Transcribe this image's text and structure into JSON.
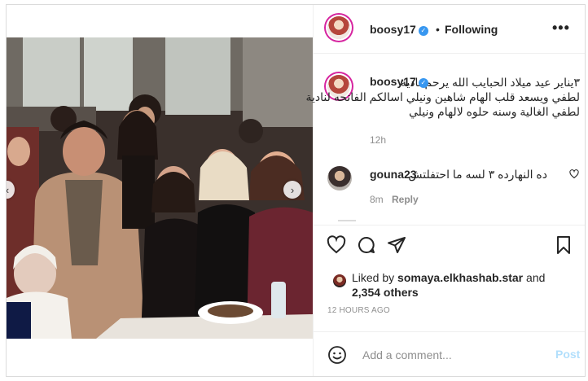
{
  "post": {
    "username": "boosy17",
    "header_separator": "•",
    "follow_status": "Following",
    "more_label": "•••",
    "caption_lines": [
      "٣يناير عيد ميلاد الحبايب الله يرحم نادية",
      "لطفي ويسعد قلب الهام شاهين ونيلي اسالكم الفاتحه لنادية",
      "لطفي الغالية وسنه حلوه لالهام ونيلي"
    ],
    "caption_time": "12h"
  },
  "comments": [
    {
      "username": "gouna23",
      "text": "ده النهارده ٣ لسه ما احتفلتش",
      "time": "8m",
      "reply_label": "Reply"
    }
  ],
  "likes": {
    "prefix": "Liked by",
    "user": "somaya.elkhashab.star",
    "and": "and",
    "others": "2,354 others"
  },
  "post_time": "12 HOURS AGO",
  "comment_box": {
    "placeholder": "Add a comment...",
    "post_label": "Post"
  },
  "icons": {
    "header_avatar": "profile-avatar",
    "verified": "verified-badge-icon",
    "like": "heart-icon",
    "comment": "comment-bubble-icon",
    "share": "paper-plane-icon",
    "save": "bookmark-icon",
    "emoji": "smiley-icon",
    "comment_like": "heart-icon"
  },
  "colors": {
    "verified": "#3897f0",
    "muted_text": "#8e8e8e",
    "post_button_disabled": "#b2dffc",
    "border": "#dbdbdb"
  }
}
